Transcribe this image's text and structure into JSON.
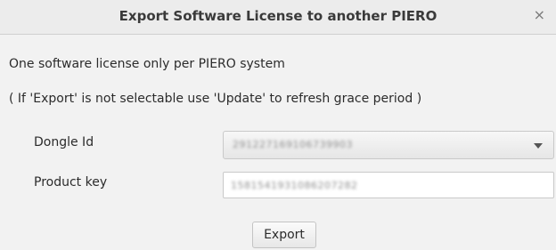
{
  "window": {
    "title": "Export Software License to another PIERO",
    "close_glyph": "×"
  },
  "messages": {
    "line1": "One software license only per PIERO system",
    "line2": "( If 'Export' is not selectable use 'Update' to refresh grace period )"
  },
  "form": {
    "dongle_id": {
      "label": "Dongle Id",
      "value": "29122716910673990​3"
    },
    "product_key": {
      "label": "Product key",
      "value": "15815419310862072​82"
    }
  },
  "buttons": {
    "export": "Export"
  },
  "icons": {
    "close": "close-icon",
    "dropdown": "chevron-down-icon"
  }
}
